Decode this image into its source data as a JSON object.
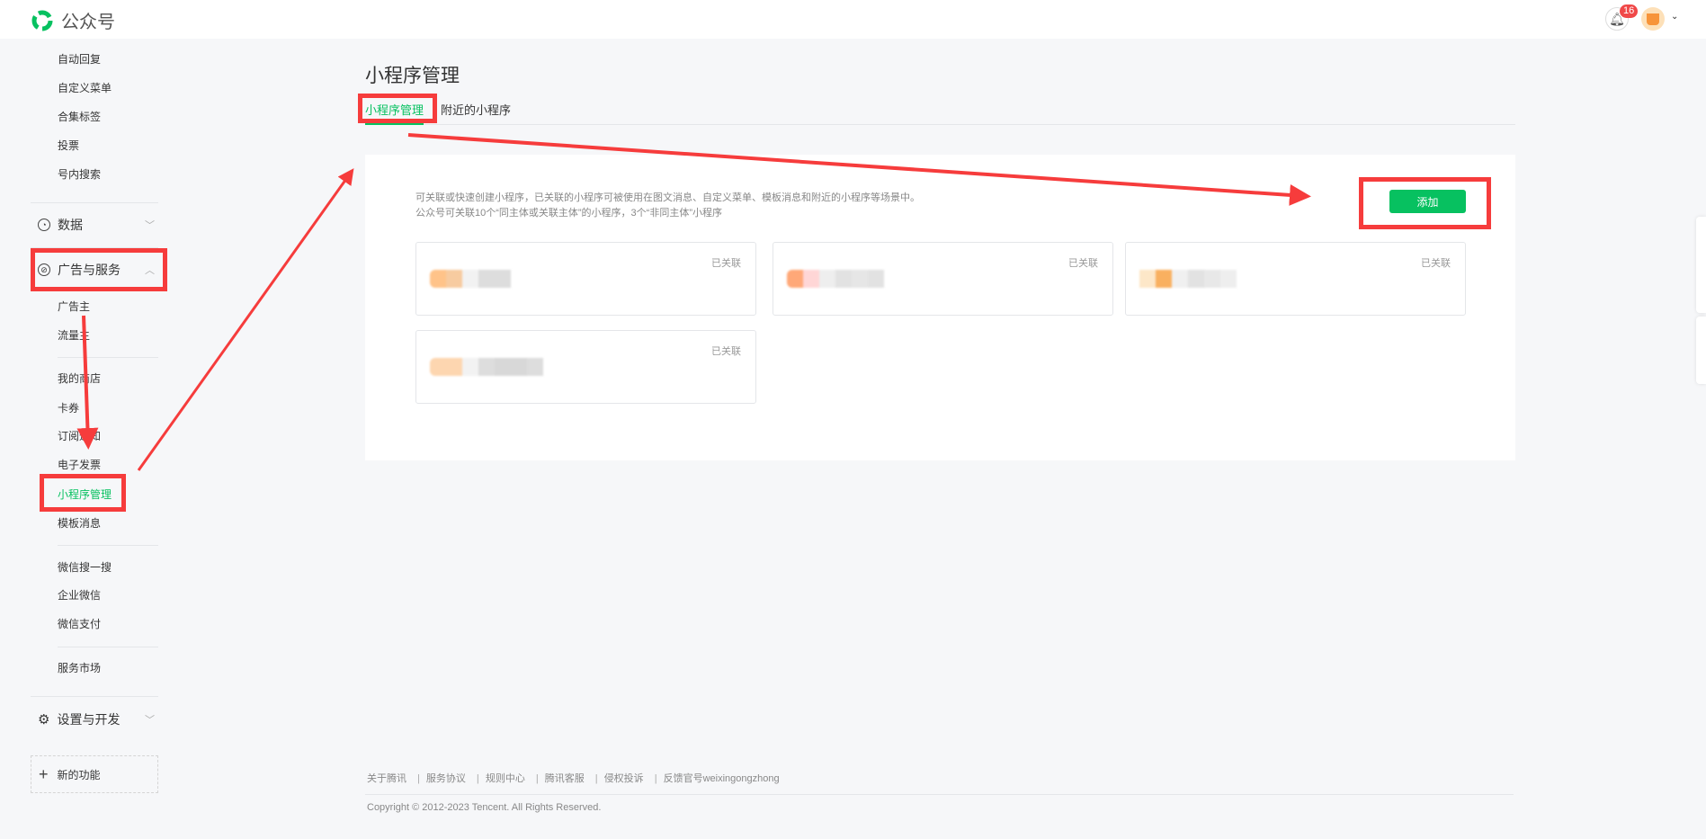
{
  "header": {
    "app_name": "公众号",
    "notification_count": "16"
  },
  "sidebar": {
    "items_top": [
      "自动回复",
      "自定义菜单",
      "合集标签",
      "投票",
      "号内搜索"
    ],
    "group_data": "数据",
    "group_ads": "广告与服务",
    "items_ads": [
      "广告主",
      "流量主"
    ],
    "items_services": [
      "我的商店",
      "卡券",
      "订阅通知",
      "电子发票",
      "小程序管理",
      "模板消息"
    ],
    "items_wechat": [
      "微信搜一搜",
      "企业微信",
      "微信支付"
    ],
    "item_market": "服务市场",
    "group_settings": "设置与开发",
    "new_features": "新的功能"
  },
  "main": {
    "title": "小程序管理",
    "tabs": [
      "小程序管理",
      "附近的小程序"
    ],
    "desc_line1": "可关联或快速创建小程序，已关联的小程序可被使用在图文消息、自定义菜单、模板消息和附近的小程序等场景中。",
    "desc_line2": "公众号可关联10个“同主体或关联主体”的小程序，3个“非同主体”小程序",
    "add_label": "添加",
    "cards": [
      {
        "status": "已关联"
      },
      {
        "status": "已关联"
      },
      {
        "status": "已关联"
      },
      {
        "status": "已关联"
      }
    ]
  },
  "footer": {
    "links": [
      "关于腾讯",
      "服务协议",
      "规则中心",
      "腾讯客服",
      "侵权投诉",
      "反馈官号weixingongzhong"
    ],
    "copyright": "Copyright © 2012-2023 Tencent. All Rights Reserved."
  },
  "colors": {
    "accent": "#07c160",
    "annotation": "#f63c3c"
  }
}
